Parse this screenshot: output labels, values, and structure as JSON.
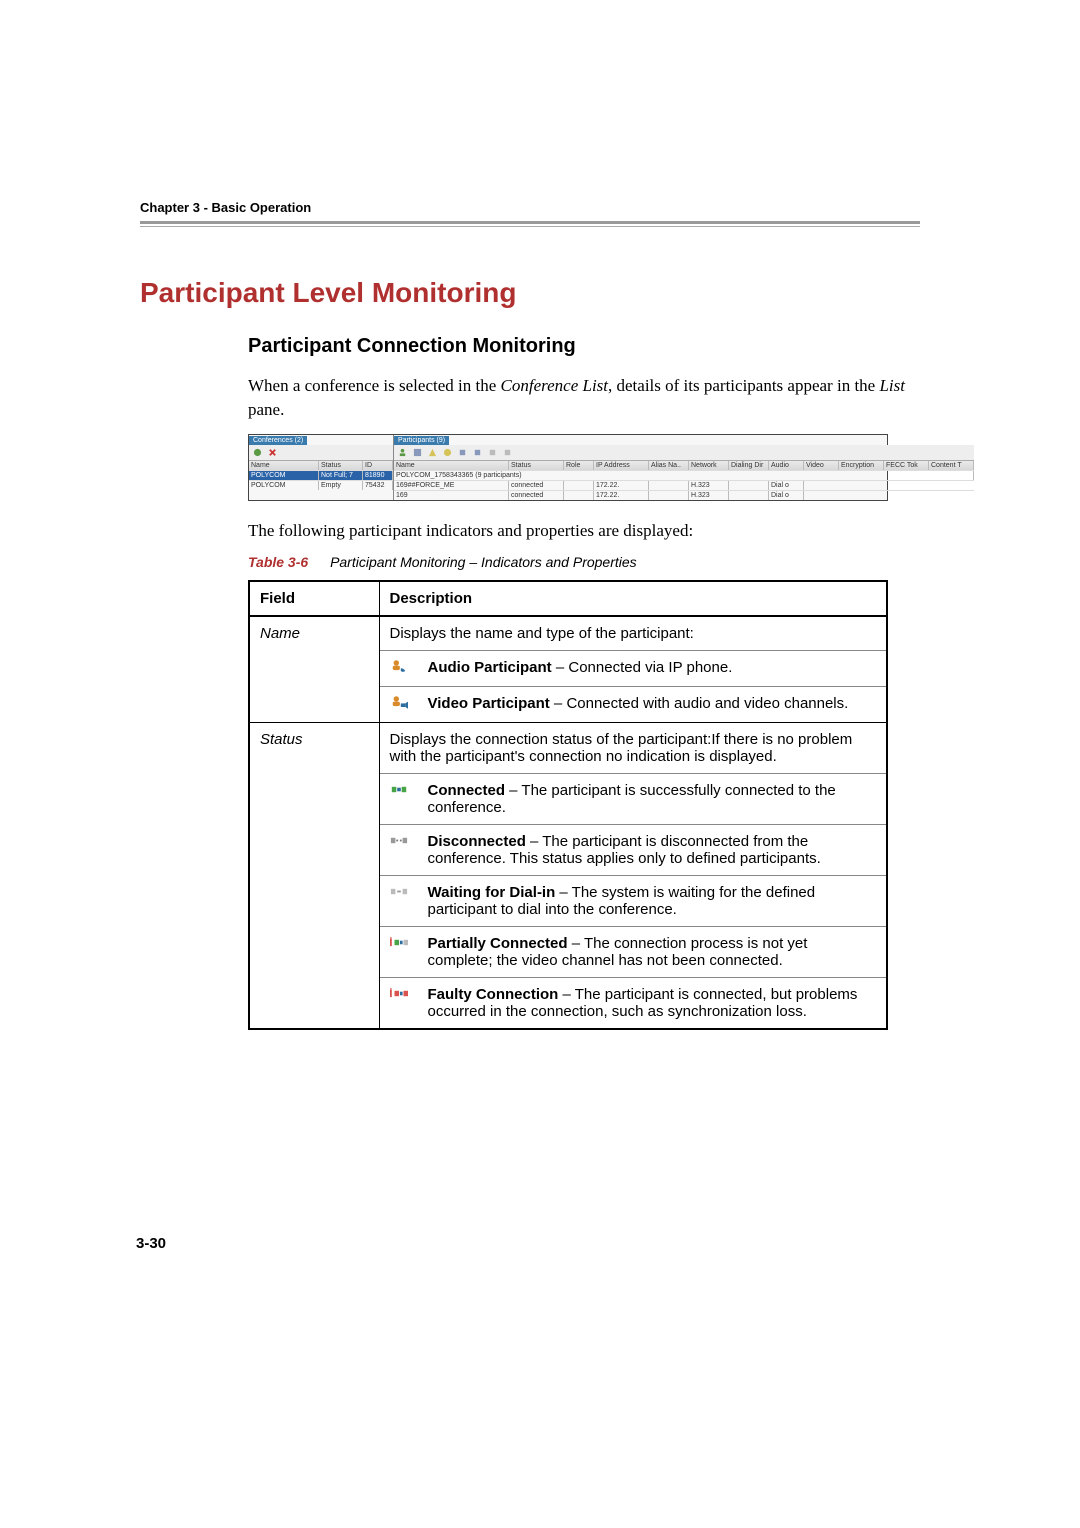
{
  "header": {
    "chapter": "Chapter 3 - Basic Operation"
  },
  "h1": "Participant Level Monitoring",
  "h2": "Participant Connection Monitoring",
  "para1_a": "When a conference is selected in the ",
  "para1_b": "Conference List",
  "para1_c": ", details of its participants appear in the ",
  "para1_d": "List",
  "para1_e": " pane.",
  "para2": "The following participant indicators and properties are displayed:",
  "table_caption": {
    "ref": "Table 3-6",
    "desc": "Participant Monitoring – Indicators and Properties"
  },
  "shot": {
    "left_tab": "Conferences (2)",
    "right_tab": "Participants (9)",
    "left_cols": [
      "Name",
      "Status",
      "ID"
    ],
    "right_cols": [
      "Name",
      "Status",
      "Role",
      "IP Address",
      "Alias Na..",
      "Network",
      "Dialing Dir",
      "Audio",
      "Video",
      "Encryption",
      "FECC Tok",
      "Content T"
    ],
    "left_rows": [
      {
        "name": "POLYCOM",
        "status": "Not Full; 7",
        "id": "81890",
        "sel": true
      },
      {
        "name": "POLYCOM",
        "status": "Empty",
        "id": "75432",
        "sel": false
      }
    ],
    "group": "POLYCOM_1758343365 (9 participants)",
    "right_rows": [
      {
        "name": "169##FORCE_ME",
        "status": "connected",
        "ip": "172.22.",
        "net": "H.323",
        "aud": "Dial o"
      },
      {
        "name": "169",
        "status": "connected",
        "ip": "172.22.",
        "net": "H.323",
        "aud": "Dial o"
      }
    ]
  },
  "table": {
    "head": {
      "field": "Field",
      "desc": "Description"
    },
    "name": {
      "label": "Name",
      "desc": "Displays the name and type of the participant:",
      "items": [
        {
          "icon": "audio-participant-icon",
          "bold": "Audio Participant",
          "text": " – Connected via IP phone."
        },
        {
          "icon": "video-participant-icon",
          "bold": "Video Participant",
          "text": " – Connected with audio and video channels."
        }
      ]
    },
    "status": {
      "label": "Status",
      "desc": "Displays the connection status of the participant:If there is no problem with the participant's connection no indication is displayed.",
      "items": [
        {
          "icon": "connected-icon",
          "bold": "Connected",
          "text": " – The participant is successfully connected to the conference."
        },
        {
          "icon": "disconnected-icon",
          "bold": "Disconnected",
          "text": " – The participant is disconnected from the conference. This status applies only to defined participants."
        },
        {
          "icon": "waiting-dialin-icon",
          "bold": "Waiting for Dial-in",
          "text": " – The system is waiting for the defined participant to dial into the conference."
        },
        {
          "icon": "partially-connected-icon",
          "bold": "Partially Connected",
          "text": " – The connection process is not yet complete; the video channel has not been connected."
        },
        {
          "icon": "faulty-connection-icon",
          "bold": "Faulty Connection",
          "text": " – The participant is connected, but problems occurred in the connection, such as synchronization loss."
        }
      ]
    }
  },
  "page_num": "3-30"
}
